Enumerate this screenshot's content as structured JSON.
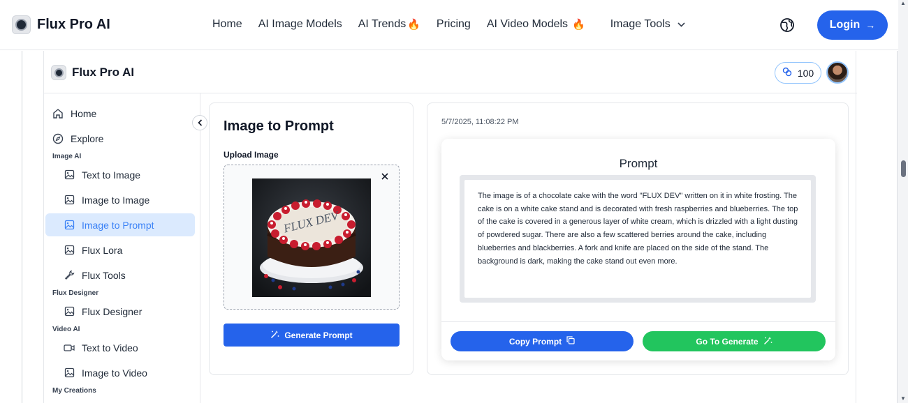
{
  "topnav": {
    "brand": "Flux Pro AI",
    "links": [
      {
        "label": "Home"
      },
      {
        "label": "AI Image Models"
      },
      {
        "label": "AI Trends"
      },
      {
        "label": "Pricing"
      },
      {
        "label": "AI Video Models"
      },
      {
        "label": "Image Tools"
      }
    ],
    "login_label": "Login"
  },
  "app_header": {
    "brand": "Flux Pro AI",
    "credits": "100"
  },
  "sidebar": {
    "home": "Home",
    "explore": "Explore",
    "section_image_ai": "Image AI",
    "text_to_image": "Text to Image",
    "image_to_image": "Image to Image",
    "image_to_prompt": "Image to Prompt",
    "flux_lora": "Flux Lora",
    "flux_tools": "Flux Tools",
    "section_flux_designer": "Flux Designer",
    "flux_designer": "Flux Designer",
    "section_video_ai": "Video AI",
    "text_to_video": "Text to Video",
    "image_to_video": "Image to Video",
    "section_my_creations": "My Creations"
  },
  "left_panel": {
    "title": "Image to Prompt",
    "upload_label": "Upload Image",
    "cake_text": "FLUX DEV",
    "generate_label": "Generate Prompt"
  },
  "right_panel": {
    "timestamp": "5/7/2025, 11:08:22 PM",
    "prompt_heading": "Prompt",
    "prompt_text": "The image is of a chocolate cake with the word \"FLUX DEV\" written on it in white frosting. The cake is on a white cake stand and is decorated with fresh raspberries and blueberries. The top of the cake is covered in a generous layer of white cream, which is drizzled with a light dusting of powdered sugar. There are also a few scattered berries around the cake, including blueberries and blackberries. A fork and knife are placed on the side of the stand. The background is dark, making the cake stand out even more.",
    "copy_label": "Copy Prompt",
    "go_label": "Go To Generate"
  },
  "colors": {
    "accent": "#2563eb",
    "success": "#22c55e",
    "active_bg": "#dbeafe",
    "active_text": "#3b82f6"
  }
}
